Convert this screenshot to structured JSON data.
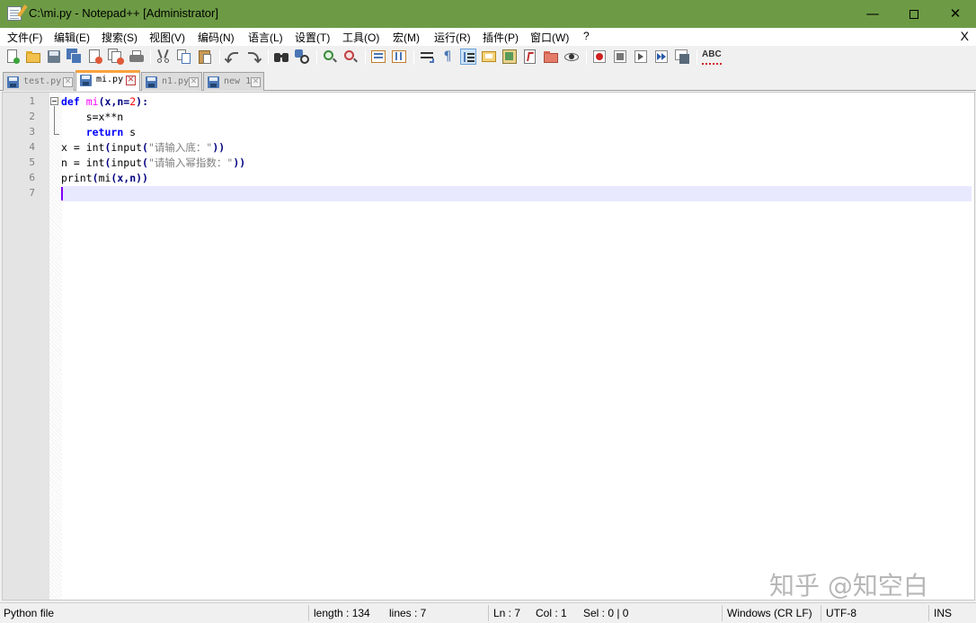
{
  "window": {
    "title": "C:\\mi.py - Notepad++ [Administrator]",
    "minimize": "—",
    "maximize": "",
    "close": "✕"
  },
  "menu": {
    "items": [
      "文件(F)",
      "编辑(E)",
      "搜索(S)",
      "视图(V)",
      "编码(N)",
      "语言(L)",
      "设置(T)",
      "工具(O)",
      "宏(M)",
      "运行(R)",
      "插件(P)",
      "窗口(W)",
      "?"
    ],
    "close": "X"
  },
  "toolbar": {
    "icons": [
      "new-file-icon",
      "open-file-icon",
      "save-icon",
      "save-all-icon",
      "close-icon",
      "close-all-icon",
      "print-icon",
      "cut-icon",
      "copy-icon",
      "paste-icon",
      "undo-icon",
      "redo-icon",
      "find-icon",
      "replace-icon",
      "zoom-in-icon",
      "zoom-out-icon",
      "sync-vertical-icon",
      "sync-horizontal-icon",
      "word-wrap-icon",
      "show-all-chars-icon",
      "indent-guide-icon",
      "udl-icon",
      "doc-map-icon",
      "function-list-icon",
      "folder-as-workspace-icon",
      "monitoring-icon",
      "record-macro-icon",
      "stop-record-icon",
      "play-macro-icon",
      "run-macro-multiple-icon",
      "save-macro-icon",
      "spell-check-icon"
    ],
    "spellcheck_label": "ABC"
  },
  "tabs": [
    {
      "label": "test.py",
      "active": false
    },
    {
      "label": "mi.py",
      "active": true
    },
    {
      "label": "n1.py",
      "active": false
    },
    {
      "label": "new 1",
      "active": false
    }
  ],
  "editor": {
    "line_numbers": [
      "1",
      "2",
      "3",
      "4",
      "5",
      "6",
      "7"
    ],
    "lines": [
      [
        {
          "t": "def",
          "c": "kw"
        },
        {
          "t": " ",
          "c": "plain"
        },
        {
          "t": "mi",
          "c": "fn"
        },
        {
          "t": "(x,n=",
          "c": "op"
        },
        {
          "t": "2",
          "c": "num"
        },
        {
          "t": "):",
          "c": "op"
        }
      ],
      [
        {
          "t": "    s=x**n",
          "c": "plain"
        }
      ],
      [
        {
          "t": "    ",
          "c": "plain"
        },
        {
          "t": "return",
          "c": "kw"
        },
        {
          "t": " s",
          "c": "plain"
        }
      ],
      [
        {
          "t": "x = ",
          "c": "plain"
        },
        {
          "t": "int",
          "c": "plain"
        },
        {
          "t": "(",
          "c": "op"
        },
        {
          "t": "input",
          "c": "plain"
        },
        {
          "t": "(",
          "c": "op"
        },
        {
          "t": "\"请输入底：\"",
          "c": "str"
        },
        {
          "t": "))",
          "c": "op"
        }
      ],
      [
        {
          "t": "n = ",
          "c": "plain"
        },
        {
          "t": "int",
          "c": "plain"
        },
        {
          "t": "(",
          "c": "op"
        },
        {
          "t": "input",
          "c": "plain"
        },
        {
          "t": "(",
          "c": "op"
        },
        {
          "t": "\"请输入幂指数：\"",
          "c": "str"
        },
        {
          "t": "))",
          "c": "op"
        }
      ],
      [
        {
          "t": "print",
          "c": "plain"
        },
        {
          "t": "(",
          "c": "op"
        },
        {
          "t": "mi",
          "c": "plain"
        },
        {
          "t": "(x,n))",
          "c": "op"
        }
      ],
      []
    ]
  },
  "watermark": "知乎 @知空白",
  "status": {
    "file_type": "Python file",
    "length": "length : 134",
    "lines": "lines : 7",
    "ln": "Ln : 7",
    "col": "Col : 1",
    "sel": "Sel : 0 | 0",
    "eol": "Windows (CR LF)",
    "encoding": "UTF-8",
    "mode": "INS"
  }
}
